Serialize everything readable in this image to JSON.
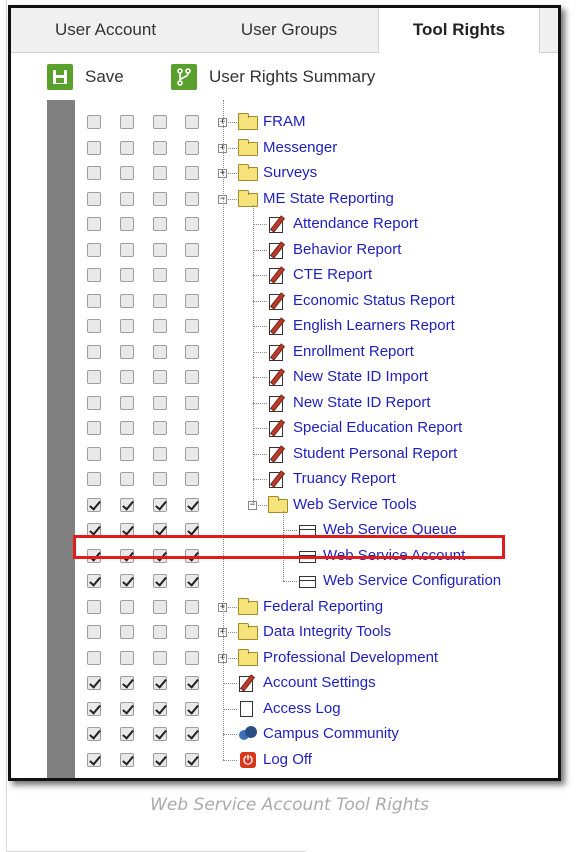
{
  "tabs": [
    {
      "label": "User Account"
    },
    {
      "label": "User Groups"
    },
    {
      "label": "Tool Rights",
      "active": true
    }
  ],
  "toolbar": {
    "save_label": "Save",
    "save_icon": "save-icon",
    "summary_label": "User Rights Summary",
    "summary_icon": "branch-icon",
    "accent_color": "#5aa02c"
  },
  "tree": [
    {
      "label": "FRAM",
      "level": 1,
      "icon": "folder",
      "expander": "+",
      "checks": [
        false,
        false,
        false,
        false
      ]
    },
    {
      "label": "Messenger",
      "level": 1,
      "icon": "folder",
      "expander": "+",
      "checks": [
        false,
        false,
        false,
        false
      ]
    },
    {
      "label": "Surveys",
      "level": 1,
      "icon": "folder",
      "expander": "+",
      "checks": [
        false,
        false,
        false,
        false
      ]
    },
    {
      "label": "ME State Reporting",
      "level": 1,
      "icon": "folder",
      "expander": "-",
      "checks": [
        false,
        false,
        false,
        false
      ]
    },
    {
      "label": "Attendance Report",
      "level": 2,
      "icon": "report",
      "checks": [
        false,
        false,
        false,
        false
      ]
    },
    {
      "label": "Behavior Report",
      "level": 2,
      "icon": "report",
      "checks": [
        false,
        false,
        false,
        false
      ]
    },
    {
      "label": "CTE Report",
      "level": 2,
      "icon": "report",
      "checks": [
        false,
        false,
        false,
        false
      ]
    },
    {
      "label": "Economic Status Report",
      "level": 2,
      "icon": "report",
      "checks": [
        false,
        false,
        false,
        false
      ]
    },
    {
      "label": "English Learners Report",
      "level": 2,
      "icon": "report",
      "checks": [
        false,
        false,
        false,
        false
      ]
    },
    {
      "label": "Enrollment Report",
      "level": 2,
      "icon": "report",
      "checks": [
        false,
        false,
        false,
        false
      ]
    },
    {
      "label": "New State ID Import",
      "level": 2,
      "icon": "report",
      "checks": [
        false,
        false,
        false,
        false
      ]
    },
    {
      "label": "New State ID Report",
      "level": 2,
      "icon": "report",
      "checks": [
        false,
        false,
        false,
        false
      ]
    },
    {
      "label": "Special Education Report",
      "level": 2,
      "icon": "report",
      "checks": [
        false,
        false,
        false,
        false
      ]
    },
    {
      "label": "Student Personal Report",
      "level": 2,
      "icon": "report",
      "checks": [
        false,
        false,
        false,
        false
      ]
    },
    {
      "label": "Truancy Report",
      "level": 2,
      "icon": "report",
      "checks": [
        false,
        false,
        false,
        false
      ]
    },
    {
      "label": "Web Service Tools",
      "level": 2,
      "icon": "folder",
      "expander": "-",
      "checks": [
        true,
        true,
        true,
        true
      ]
    },
    {
      "label": "Web Service Queue",
      "level": 3,
      "icon": "window",
      "checks": [
        true,
        true,
        true,
        true
      ]
    },
    {
      "label": "Web Service Account",
      "level": 3,
      "icon": "window",
      "checks": [
        true,
        true,
        true,
        true
      ],
      "highlighted": true
    },
    {
      "label": "Web Service Configuration",
      "level": 3,
      "icon": "window",
      "checks": [
        true,
        true,
        true,
        true
      ]
    },
    {
      "label": "Federal Reporting",
      "level": 1,
      "icon": "folder",
      "expander": "+",
      "checks": [
        false,
        false,
        false,
        false
      ]
    },
    {
      "label": "Data Integrity Tools",
      "level": 1,
      "icon": "folder",
      "expander": "+",
      "checks": [
        false,
        false,
        false,
        false
      ]
    },
    {
      "label": "Professional Development",
      "level": 1,
      "icon": "folder",
      "expander": "+",
      "checks": [
        false,
        false,
        false,
        false
      ]
    },
    {
      "label": "Account Settings",
      "level": 1,
      "icon": "report",
      "checks": [
        true,
        true,
        true,
        true
      ]
    },
    {
      "label": "Access Log",
      "level": 1,
      "icon": "page",
      "checks": [
        true,
        true,
        true,
        true
      ]
    },
    {
      "label": "Campus Community",
      "level": 1,
      "icon": "community",
      "checks": [
        true,
        true,
        true,
        true
      ]
    },
    {
      "label": "Log Off",
      "level": 1,
      "icon": "logoff",
      "checks": [
        true,
        true,
        true,
        true
      ]
    }
  ],
  "highlight_color": "#e21b1b",
  "link_color": "#1f1fbd",
  "caption": "Web Service Account Tool Rights"
}
